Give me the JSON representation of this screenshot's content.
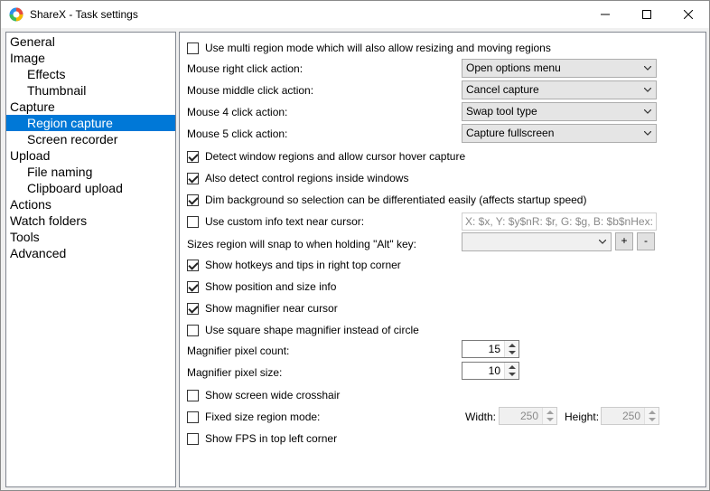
{
  "window": {
    "title": "ShareX - Task settings"
  },
  "nav": {
    "items": [
      {
        "label": "General"
      },
      {
        "label": "Image"
      },
      {
        "label": "Effects"
      },
      {
        "label": "Thumbnail"
      },
      {
        "label": "Capture"
      },
      {
        "label": "Region capture"
      },
      {
        "label": "Screen recorder"
      },
      {
        "label": "Upload"
      },
      {
        "label": "File naming"
      },
      {
        "label": "Clipboard upload"
      },
      {
        "label": "Actions"
      },
      {
        "label": "Watch folders"
      },
      {
        "label": "Tools"
      },
      {
        "label": "Advanced"
      }
    ],
    "selected": "Region capture"
  },
  "region": {
    "multi_region": {
      "label": "Use multi region mode which will also allow resizing and moving regions",
      "checked": false
    },
    "mouse_right": {
      "label": "Mouse right click action:",
      "value": "Open options menu"
    },
    "mouse_middle": {
      "label": "Mouse middle click action:",
      "value": "Cancel capture"
    },
    "mouse4": {
      "label": "Mouse 4 click action:",
      "value": "Swap tool type"
    },
    "mouse5": {
      "label": "Mouse 5 click action:",
      "value": "Capture fullscreen"
    },
    "detect_window": {
      "label": "Detect window regions and allow cursor hover capture",
      "checked": true
    },
    "detect_control": {
      "label": "Also detect control regions inside windows",
      "checked": true
    },
    "dim_bg": {
      "label": "Dim background so selection can be differentiated easily (affects startup speed)",
      "checked": true
    },
    "custom_info": {
      "label": "Use custom info text near cursor:",
      "checked": false,
      "value": "X: $x, Y: $y$nR: $r, G: $g, B: $b$nHex: $hex"
    },
    "snap_sizes": {
      "label": "Sizes region will snap to when holding \"Alt\" key:",
      "add": "+",
      "remove": "-"
    },
    "hotkeys_tips": {
      "label": "Show hotkeys and tips in right top corner",
      "checked": true
    },
    "pos_size": {
      "label": "Show position and size info",
      "checked": true
    },
    "magnifier": {
      "label": "Show magnifier near cursor",
      "checked": true
    },
    "square_mag": {
      "label": "Use square shape magnifier instead of circle",
      "checked": false
    },
    "mag_count": {
      "label": "Magnifier pixel count:",
      "value": "15"
    },
    "mag_size": {
      "label": "Magnifier pixel size:",
      "value": "10"
    },
    "crosshair": {
      "label": "Show screen wide crosshair",
      "checked": false
    },
    "fixed_size": {
      "label": "Fixed size region mode:",
      "checked": false,
      "width_label": "Width:",
      "width": "250",
      "height_label": "Height:",
      "height": "250"
    },
    "fps": {
      "label": "Show FPS in top left corner",
      "checked": false
    }
  }
}
